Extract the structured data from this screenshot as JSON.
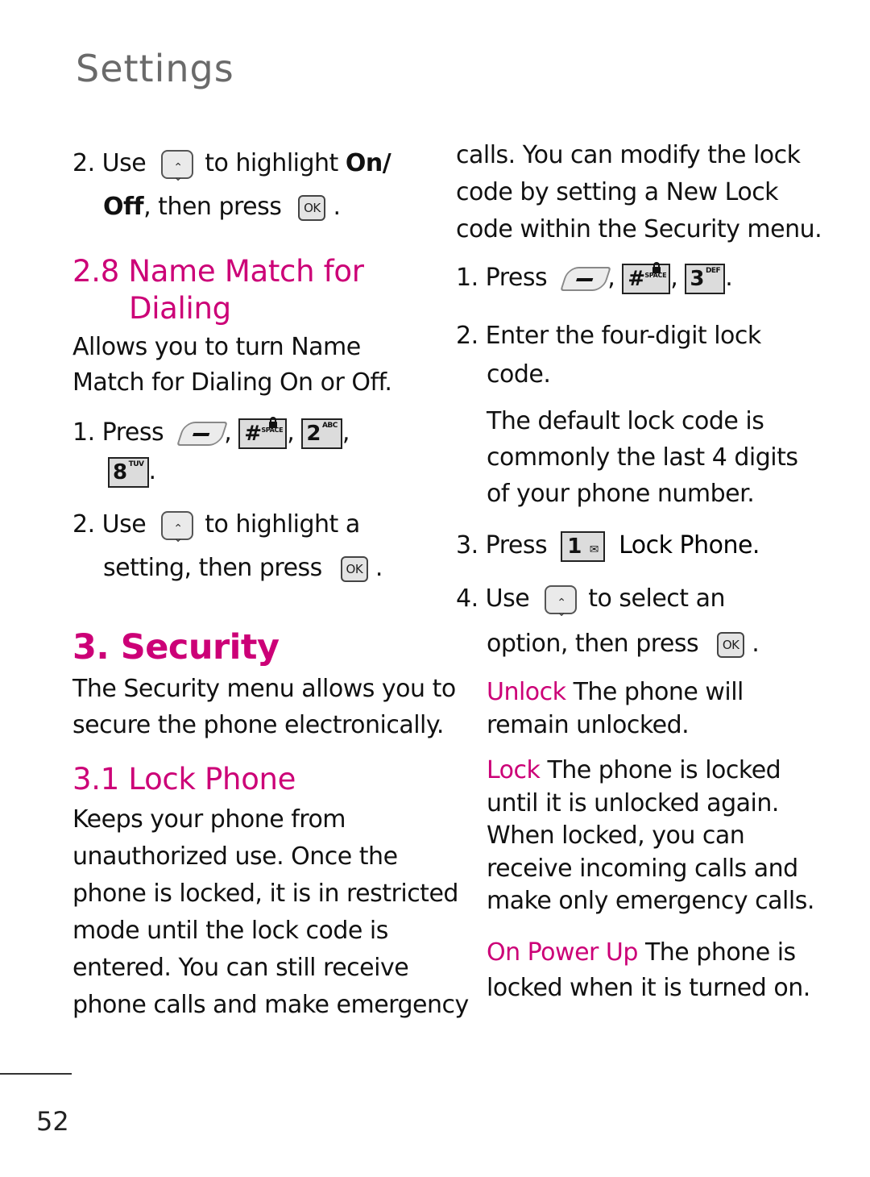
{
  "page": {
    "section_title": "Settings",
    "page_number": "52",
    "accent_color": "#cc0077"
  },
  "left": {
    "step2_onoff": {
      "num": "2.",
      "use": "Use",
      "to_highlight": "to highlight",
      "on_slash": "On/",
      "off": "Off",
      "then_press": ", then press",
      "period": "."
    },
    "name_match": {
      "heading_line1": "2.8 Name Match for",
      "heading_line2": "Dialing",
      "desc_line1": "Allows you to turn Name",
      "desc_line2": "Match for Dialing On or Off.",
      "step1": {
        "num": "1.",
        "press": "Press",
        "keys": [
          "soft-left-key",
          "hash-space-key",
          "2-abc-key",
          "8-tuv-key"
        ]
      },
      "step2": {
        "num": "2.",
        "use": "Use",
        "line1_rest": "to highlight a",
        "line2": "setting, then press",
        "period": "."
      }
    },
    "security": {
      "heading": "3. Security",
      "desc_line1": "The Security menu allows you to",
      "desc_line2": "secure the phone electronically."
    },
    "lock_phone": {
      "heading": "3.1  Lock Phone",
      "desc_lines": [
        "Keeps your phone from",
        "unauthorized use. Once the",
        "phone is locked, it is in restricted",
        "mode until the lock code is",
        "entered. You can still receive",
        "phone calls and make emergency"
      ]
    }
  },
  "right": {
    "cont_lines": [
      "calls. You can modify the lock",
      "code by setting a New Lock",
      "code within the Security menu."
    ],
    "step1": {
      "num": "1.",
      "press": "Press",
      "keys": [
        "soft-left-key",
        "hash-space-key",
        "3-def-key"
      ]
    },
    "step2": {
      "num": "2.",
      "line1": "Enter the four-digit lock",
      "line2": "code.",
      "note_lines": [
        "The default lock code is",
        "commonly the last 4 digits",
        "of your phone number."
      ]
    },
    "step3": {
      "num": "3.",
      "press": "Press",
      "target": "Lock Phone."
    },
    "step4": {
      "num": "4.",
      "use": "Use",
      "line1_rest": "to select an",
      "line2": "option, then press",
      "period": "."
    },
    "options": [
      {
        "label": "Unlock",
        "lines": [
          "The phone will",
          "remain unlocked."
        ]
      },
      {
        "label": "Lock",
        "lines": [
          "The phone is locked",
          "until it is unlocked again.",
          "When locked, you can",
          "receive incoming calls and",
          "make only emergency calls."
        ]
      },
      {
        "label": "On Power Up",
        "lines": [
          "The phone is",
          "locked when it is turned on."
        ]
      }
    ],
    "key_labels": {
      "k1": "1",
      "k2": "2",
      "k2sub": "ABC",
      "k3": "3",
      "k3sub": "DEF",
      "k8": "8",
      "k8sub": "TUV",
      "hash": "#",
      "space": "SPACE",
      "ok": "OK"
    }
  }
}
